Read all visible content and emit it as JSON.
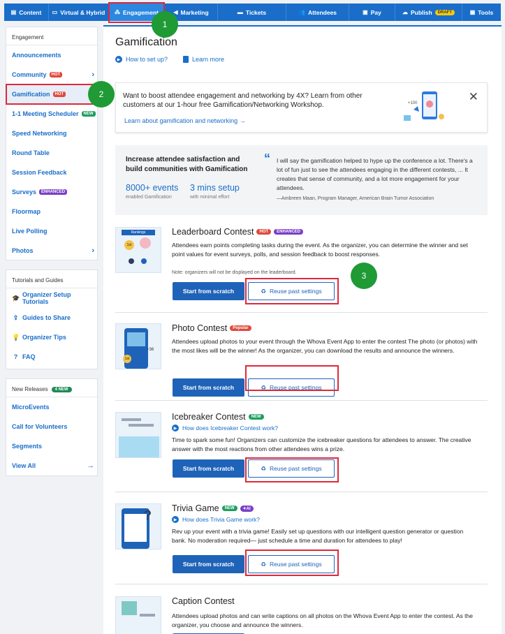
{
  "nav": {
    "items": [
      {
        "label": "Content",
        "icon": "content-icon"
      },
      {
        "label": "Virtual & Hybrid",
        "icon": "monitor-icon"
      },
      {
        "label": "Engagement",
        "icon": "network-icon"
      },
      {
        "label": "Marketing",
        "icon": "megaphone-icon"
      },
      {
        "label": "Tickets",
        "icon": "ticket-icon"
      },
      {
        "label": "Attendees",
        "icon": "people-icon"
      },
      {
        "label": "Pay",
        "icon": "wallet-icon"
      },
      {
        "label": "Publish",
        "icon": "cloud-upload-icon",
        "badge": "DRAFT"
      },
      {
        "label": "Tools",
        "icon": "toolbox-icon"
      }
    ]
  },
  "sidebar": {
    "engagement": {
      "header": "Engagement",
      "items": [
        {
          "label": "Announcements"
        },
        {
          "label": "Community",
          "badge": "HOT"
        },
        {
          "label": "Gamification",
          "badge": "HOT"
        },
        {
          "label": "1-1 Meeting Scheduler",
          "badge": "NEW"
        },
        {
          "label": "Speed Networking"
        },
        {
          "label": "Round Table"
        },
        {
          "label": "Session Feedback"
        },
        {
          "label": "Surveys",
          "badge": "ENHANCED"
        },
        {
          "label": "Floormap"
        },
        {
          "label": "Live Polling"
        },
        {
          "label": "Photos"
        }
      ]
    },
    "tutorials": {
      "header": "Tutorials and Guides",
      "items": [
        {
          "label": "Organizer Setup Tutorials"
        },
        {
          "label": "Guides to Share"
        },
        {
          "label": "Organizer Tips"
        },
        {
          "label": "FAQ"
        }
      ]
    },
    "releases": {
      "header": "New Releases",
      "badge": "4 NEW",
      "items": [
        {
          "label": "MicroEvents"
        },
        {
          "label": "Call for Volunteers"
        },
        {
          "label": "Segments"
        },
        {
          "label": "View All"
        }
      ]
    }
  },
  "main": {
    "title": "Gamification",
    "how_to": "How to set up?",
    "learn_more": "Learn more",
    "promo": {
      "text": "Want to boost attendee engagement and networking by 4X? Learn from other customers at our 1-hour free Gamification/Networking Workshop.",
      "link": "Learn about gamification and networking",
      "close": "✕",
      "image_badge": "+100"
    },
    "stats": {
      "headline": "Increase attendee satisfaction and build communities with Gamification",
      "stat1_value": "8000+ events",
      "stat1_caption": "enabled Gamification",
      "stat2_value": "3 mins setup",
      "stat2_caption": "with minimal effort",
      "quote": "I will say the gamification helped to hype up the conference a lot. There's a lot of fun just to see the attendees engaging in the different contests, ... It creates that sense of community, and a lot more engagement for your attendees.",
      "author": "—Ambreen Maan, Program Manager, American Brain Tumor Association"
    },
    "cards": [
      {
        "title": "Leaderboard Contest",
        "badges": [
          "HOT",
          "ENHANCED"
        ],
        "description": "Attendees earn points completing tasks during the event. As the organizer, you can determine the winner and set point values for event surveys, polls, and session feedback to boost responses.",
        "note": "Note: organizers will not be displayed on the leaderboard.",
        "thumb_label": "Rankings",
        "thumb_first": "1st"
      },
      {
        "title": "Photo Contest",
        "badges": [
          "Popular"
        ],
        "description": "Attendees upload photos to your event through the Whova Event App to enter the contest The photo (or photos) with the most likes will be the winner! As the organizer, you can download the results and announce the winners.",
        "thumb_count": "+36",
        "thumb_first": "1st"
      },
      {
        "title": "Icebreaker Contest",
        "badges": [
          "NEW"
        ],
        "link": "How does Icebreaker Contest work?",
        "description": "Time to spark some fun! Organizers can customize the icebreaker questions for attendees to answer. The creative answer with the most reactions from other attendees wins a prize."
      },
      {
        "title": "Trivia Game",
        "badges": [
          "NEW",
          "AI"
        ],
        "link": "How does Trivia Game work?",
        "description": "Rev up your event with a trivia game! Easily set up questions with our intelligent question generator or question bank. No moderation required— just schedule a time and duration for attendees to play!"
      },
      {
        "title": "Caption Contest",
        "badges": [],
        "description": "Attendees upload photos and can write captions on all photos on the Whova Event App to enter the contest. As the organizer, you choose and announce the winners."
      }
    ],
    "start_label": "Start from scratch",
    "reuse_label": "Reuse past settings"
  },
  "steps": [
    "1",
    "2",
    "3"
  ],
  "colors": {
    "primary": "#1a6ec9",
    "annotation_red": "#e0283b",
    "step_green": "#1f9a35",
    "hot": "#e04a3d",
    "new": "#1f9f5f",
    "enhanced": "#7a3fc7"
  }
}
